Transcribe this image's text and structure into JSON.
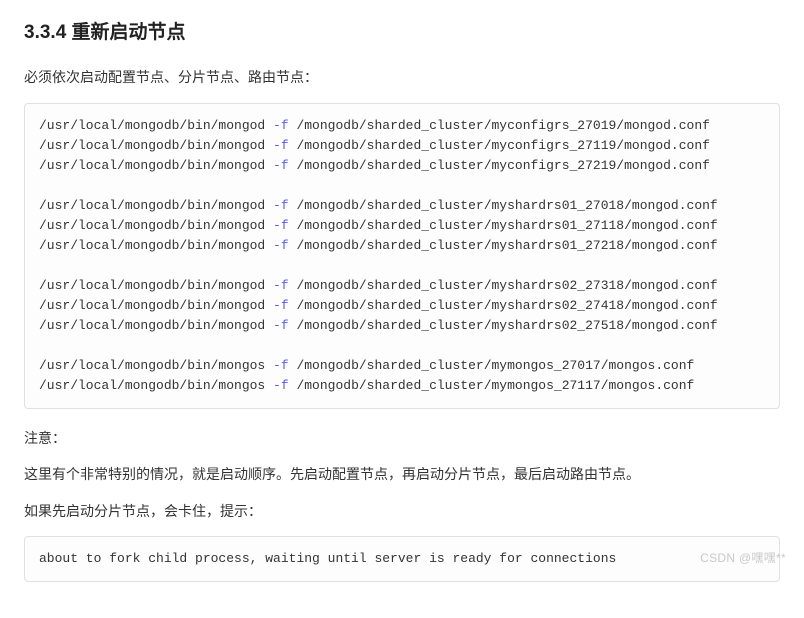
{
  "heading": "3.3.4 重新启动节点",
  "intro": "必须依次启动配置节点、分片节点、路由节点：",
  "cmd": {
    "bin_mongod": "/usr/local/mongodb/bin/mongod ",
    "bin_mongos": "/usr/local/mongodb/bin/mongos ",
    "flag": "-f",
    "c1": " /mongodb/sharded_cluster/myconfigrs_27019/mongod.conf",
    "c2": " /mongodb/sharded_cluster/myconfigrs_27119/mongod.conf",
    "c3": " /mongodb/sharded_cluster/myconfigrs_27219/mongod.conf",
    "s1a": " /mongodb/sharded_cluster/myshardrs01_27018/mongod.conf",
    "s1b": " /mongodb/sharded_cluster/myshardrs01_27118/mongod.conf",
    "s1c": " /mongodb/sharded_cluster/myshardrs01_27218/mongod.conf",
    "s2a": " /mongodb/sharded_cluster/myshardrs02_27318/mongod.conf",
    "s2b": " /mongodb/sharded_cluster/myshardrs02_27418/mongod.conf",
    "s2c": " /mongodb/sharded_cluster/myshardrs02_27518/mongod.conf",
    "m1": " /mongodb/sharded_cluster/mymongos_27017/mongos.conf",
    "m2": " /mongodb/sharded_cluster/mymongos_27117/mongos.conf"
  },
  "note_label": "注意：",
  "note_body": "这里有个非常特别的情况，就是启动顺序。先启动配置节点，再启动分片节点，最后启动路由节点。",
  "note_warn": "如果先启动分片节点，会卡住，提示：",
  "hang_msg": "about to fork child process, waiting until server is ready for connections",
  "watermark": "CSDN @嘿嘿**"
}
